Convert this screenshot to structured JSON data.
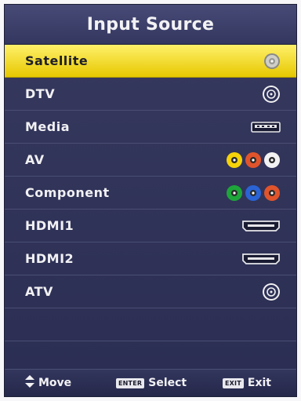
{
  "menu": {
    "title": "Input Source",
    "items": [
      {
        "label": "Satellite",
        "icon": "satellite-connector-icon",
        "selected": true
      },
      {
        "label": "DTV",
        "icon": "antenna-connector-icon"
      },
      {
        "label": "Media",
        "icon": "usb-port-icon"
      },
      {
        "label": "AV",
        "icon": "rca-av-jacks-icon"
      },
      {
        "label": "Component",
        "icon": "rca-component-jacks-icon"
      },
      {
        "label": "HDMI1",
        "icon": "hdmi-port-icon"
      },
      {
        "label": "HDMI2",
        "icon": "hdmi-port-icon"
      },
      {
        "label": "ATV",
        "icon": "antenna-connector-icon"
      }
    ]
  },
  "footer": {
    "move_label": "Move",
    "select_key": "ENTER",
    "select_label": "Select",
    "exit_key": "EXIT",
    "exit_label": "Exit"
  },
  "colors": {
    "highlight": "#f5dc1c",
    "background": "#2f3258",
    "text": "#f1f1f4",
    "av_yellow": "#f5d20a",
    "av_red": "#e0542c",
    "av_white": "#f2f2f2",
    "comp_green": "#1ea53a",
    "comp_blue": "#2a63d4",
    "comp_red": "#e0542c"
  }
}
